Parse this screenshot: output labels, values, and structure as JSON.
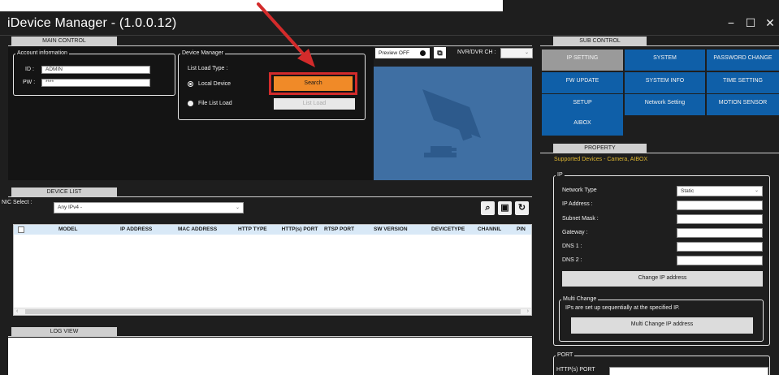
{
  "window": {
    "title": "iDevice Manager - (1.0.0.12)",
    "controls": {
      "minimize": "−",
      "maximize": "☐",
      "close": "✕"
    }
  },
  "main_control": {
    "tab": "MAIN CONTROL",
    "account": {
      "legend": "Account information",
      "id_label": "ID :",
      "id_value": "ADMIN",
      "pw_label": "PW :",
      "pw_value": "****"
    },
    "device_manager": {
      "legend": "Device Manager",
      "list_load_type": "List Load Type :",
      "local_device": "Local Device",
      "file_list_load": "File List Load",
      "search_button": "Search",
      "list_load_button": "List Load"
    },
    "preview": {
      "toggle_label": "Preview OFF",
      "nvr_label": "NVR/DVR CH :",
      "nvr_value": ""
    }
  },
  "device_list": {
    "tab": "DEVICE LIST",
    "nic_label": "NIC Select :",
    "nic_value": "Any IPv4 -",
    "columns": [
      "MODEL",
      "IP ADDRESS",
      "MAC ADDRESS",
      "HTTP TYPE",
      "HTTP(s) PORT",
      "RTSP PORT",
      "SW VERSION",
      "DEVICETYPE",
      "CHANNIL",
      "PIN"
    ],
    "rows": []
  },
  "log_view": {
    "tab": "LOG VIEW"
  },
  "sub_control": {
    "tab": "SUB CONTROL",
    "buttons": [
      {
        "label": "IP SETTING",
        "selected": true
      },
      {
        "label": "SYSTEM",
        "selected": false
      },
      {
        "label": "PASSWORD CHANGE",
        "selected": false
      },
      {
        "label": "FW UPDATE",
        "selected": false
      },
      {
        "label": "SYSTEM INFO",
        "selected": false
      },
      {
        "label": "TIME SETTING",
        "selected": false
      },
      {
        "label": "SETUP",
        "selected": false
      },
      {
        "label": "Network Setting",
        "selected": false
      },
      {
        "label": "MOTION SENSOR",
        "selected": false
      },
      {
        "label": "AIBOX",
        "selected": false
      }
    ]
  },
  "property": {
    "tab": "PROPERTY",
    "supported": "Supported Devices - Camera, AIBOX",
    "ip": {
      "legend": "IP",
      "network_type_label": "Network Type",
      "network_type_value": "Static",
      "ip_address_label": "IP Address :",
      "subnet_mask_label": "Subnet Mask :",
      "gateway_label": "Gateway :",
      "dns1_label": "DNS 1 :",
      "dns2_label": "DNS 2 :",
      "change_ip_button": "Change IP address",
      "multi_change": {
        "legend": "Multi Change",
        "description": "IPs are set up sequentially at the specified IP.",
        "button": "Multi Change IP address"
      }
    },
    "port": {
      "legend": "PORT",
      "http_port_label": "HTTP(s) PORT"
    }
  },
  "colors": {
    "accent_orange": "#f08a28",
    "highlight_red": "#d32b2b",
    "button_blue": "#0f5fa8",
    "preview_blue": "#3f6fa3",
    "supported_text": "#e0b832"
  }
}
